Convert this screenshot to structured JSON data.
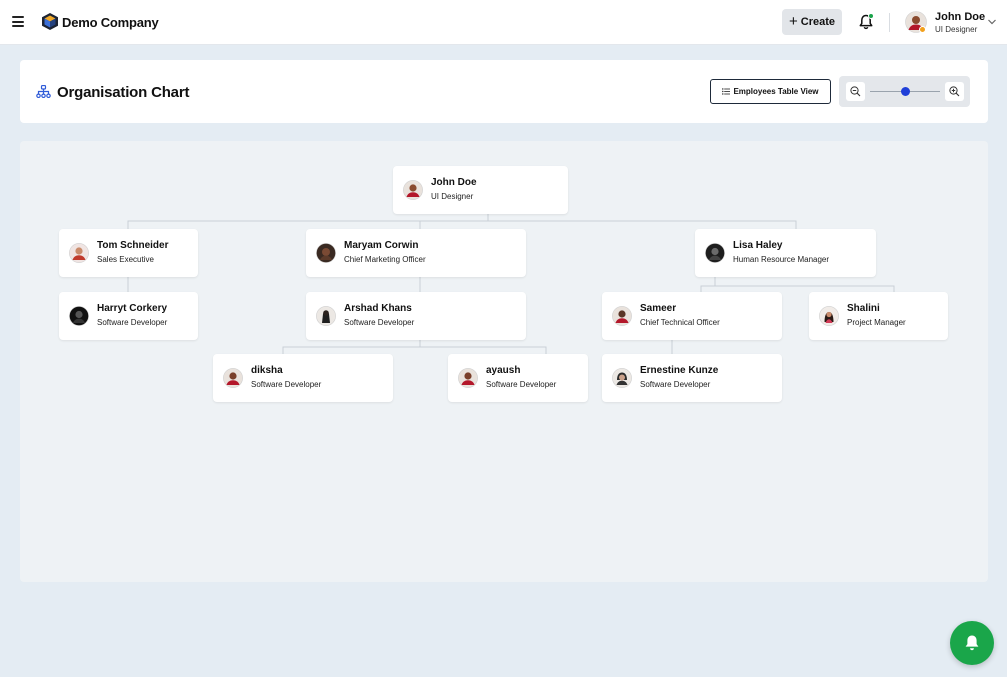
{
  "topbar": {
    "company_name": "Demo Company",
    "create_label": "Create",
    "user": {
      "name": "John Doe",
      "role": "UI Designer"
    },
    "notification_dot_color": "#1aa34a",
    "status_dot_color": "#f2a01c"
  },
  "header": {
    "title": "Organisation Chart",
    "table_view_label": "Employees Table View",
    "zoom_level": 0.5
  },
  "org_chart": {
    "nodes": [
      {
        "id": "root",
        "name": "John Doe",
        "role": "UI Designer",
        "parent": null
      },
      {
        "id": "tom",
        "name": "Tom Schneider",
        "role": "Sales Executive",
        "parent": "root"
      },
      {
        "id": "maryam",
        "name": "Maryam Corwin",
        "role": "Chief Marketing Officer",
        "parent": "root"
      },
      {
        "id": "lisa",
        "name": "Lisa Haley",
        "role": "Human Resource Manager",
        "parent": "root"
      },
      {
        "id": "harryt",
        "name": "Harryt Corkery",
        "role": "Software Developer",
        "parent": "tom"
      },
      {
        "id": "arshad",
        "name": "Arshad Khans",
        "role": "Software Developer",
        "parent": "maryam"
      },
      {
        "id": "sameer",
        "name": "Sameer",
        "role": "Chief Technical Officer",
        "parent": "lisa"
      },
      {
        "id": "shalini",
        "name": "Shalini",
        "role": "Project Manager",
        "parent": "lisa"
      },
      {
        "id": "diksha",
        "name": "diksha",
        "role": "Software Developer",
        "parent": "arshad"
      },
      {
        "id": "ayaush",
        "name": "ayaush",
        "role": "Software Developer",
        "parent": "arshad"
      },
      {
        "id": "ernestine",
        "name": "Ernestine Kunze",
        "role": "Software Developer",
        "parent": "sameer"
      }
    ]
  },
  "colors": {
    "accent": "#1f3fd8",
    "fab": "#1aa64a",
    "background": "#e4ecf3"
  }
}
